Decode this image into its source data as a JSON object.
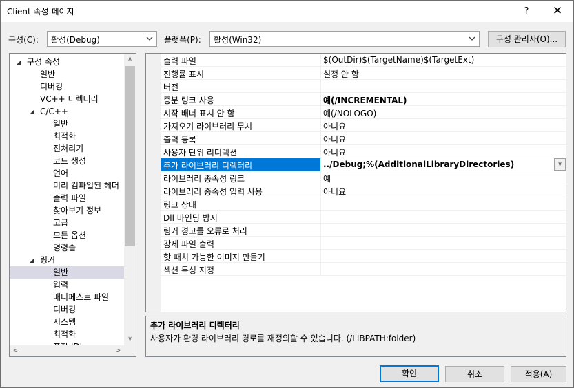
{
  "window": {
    "title": "Client 속성 페이지",
    "help_label": "?",
    "close_label": "✕"
  },
  "toolbar": {
    "configuration_label": "구성(C):",
    "configuration_value": "활성(Debug)",
    "platform_label": "플랫폼(P):",
    "platform_value": "활성(Win32)",
    "config_manager_label": "구성 관리자(O)..."
  },
  "tree": {
    "items": [
      {
        "label": "구성 속성",
        "expander": "◢"
      },
      {
        "label": "일반"
      },
      {
        "label": "디버깅"
      },
      {
        "label": "VC++ 디렉터리"
      },
      {
        "label": "C/C++",
        "expander": "◢"
      },
      {
        "label": "일반"
      },
      {
        "label": "최적화"
      },
      {
        "label": "전처리기"
      },
      {
        "label": "코드 생성"
      },
      {
        "label": "언어"
      },
      {
        "label": "미리 컴파일된 헤더"
      },
      {
        "label": "출력 파일"
      },
      {
        "label": "찾아보기 정보"
      },
      {
        "label": "고급"
      },
      {
        "label": "모든 옵션"
      },
      {
        "label": "명령줄"
      },
      {
        "label": "링커",
        "expander": "◢"
      },
      {
        "label": "일반"
      },
      {
        "label": "입력"
      },
      {
        "label": "매니페스트 파일"
      },
      {
        "label": "디버깅"
      },
      {
        "label": "시스템"
      },
      {
        "label": "최적화"
      },
      {
        "label": "포함 IDL"
      }
    ],
    "scroll_up": "∧",
    "scroll_down": "∨",
    "scroll_left": "<",
    "scroll_right": ">"
  },
  "properties": {
    "rows": [
      {
        "name": "출력 파일",
        "value": "$(OutDir)$(TargetName)$(TargetExt)"
      },
      {
        "name": "진행률 표시",
        "value": "설정 안 함"
      },
      {
        "name": "버전",
        "value": ""
      },
      {
        "name": "증분 링크 사용",
        "value": "예(/INCREMENTAL)"
      },
      {
        "name": "시작 배너 표시 안 함",
        "value": "예(/NOLOGO)"
      },
      {
        "name": "가져오기 라이브러리 무시",
        "value": "아니요"
      },
      {
        "name": "출력 등록",
        "value": "아니요"
      },
      {
        "name": "사용자 단위 리디렉션",
        "value": "아니요"
      },
      {
        "name": "추가 라이브러리 디렉터리",
        "value": "../Debug;%(AdditionalLibraryDirectories)"
      },
      {
        "name": "라이브러리 종속성 링크",
        "value": "예"
      },
      {
        "name": "라이브러리 종속성 입력 사용",
        "value": "아니요"
      },
      {
        "name": "링크 상태",
        "value": ""
      },
      {
        "name": "Dll 바인딩 방지",
        "value": ""
      },
      {
        "name": "링커 경고를 오류로 처리",
        "value": ""
      },
      {
        "name": "강제 파일 출력",
        "value": ""
      },
      {
        "name": "핫 패치 가능한 이미지 만들기",
        "value": ""
      },
      {
        "name": "섹션 특성 지정",
        "value": ""
      }
    ],
    "dropdown_glyph": "∨"
  },
  "description": {
    "title": "추가 라이브러리 디렉터리",
    "text": "사용자가 환경 라이브러리 경로를 재정의할 수 있습니다. (/LIBPATH:folder)"
  },
  "buttons": {
    "ok": "확인",
    "cancel": "취소",
    "apply": "적용(A)"
  }
}
